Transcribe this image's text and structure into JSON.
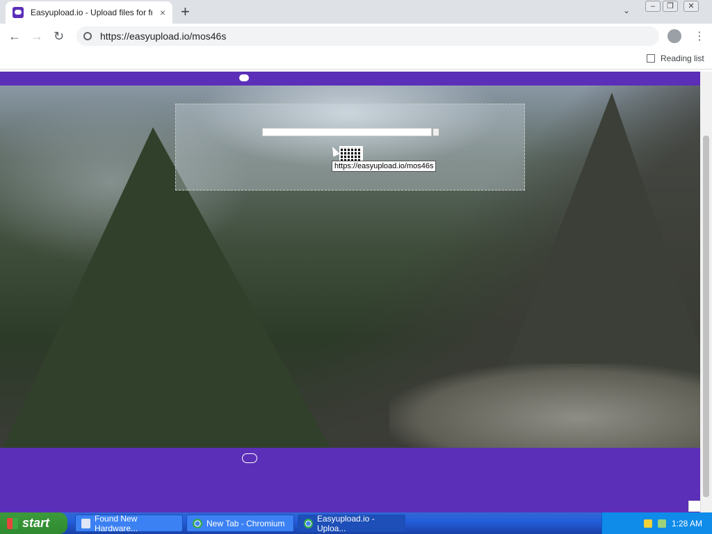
{
  "browser": {
    "tab_title": "Easyupload.io - Upload files for free",
    "tab_close": "×",
    "new_tab": "+",
    "url": "https://easyupload.io/mos46s",
    "reading_list": "Reading list"
  },
  "page": {
    "tooltip": "https://easyupload.io/mos46s"
  },
  "taskbar": {
    "start_label": "start",
    "tasks": [
      {
        "label": "Found New Hardware..."
      },
      {
        "label": "New Tab - Chromium"
      },
      {
        "label": "Easyupload.io - Uploa..."
      }
    ],
    "clock": "1:28 AM"
  }
}
